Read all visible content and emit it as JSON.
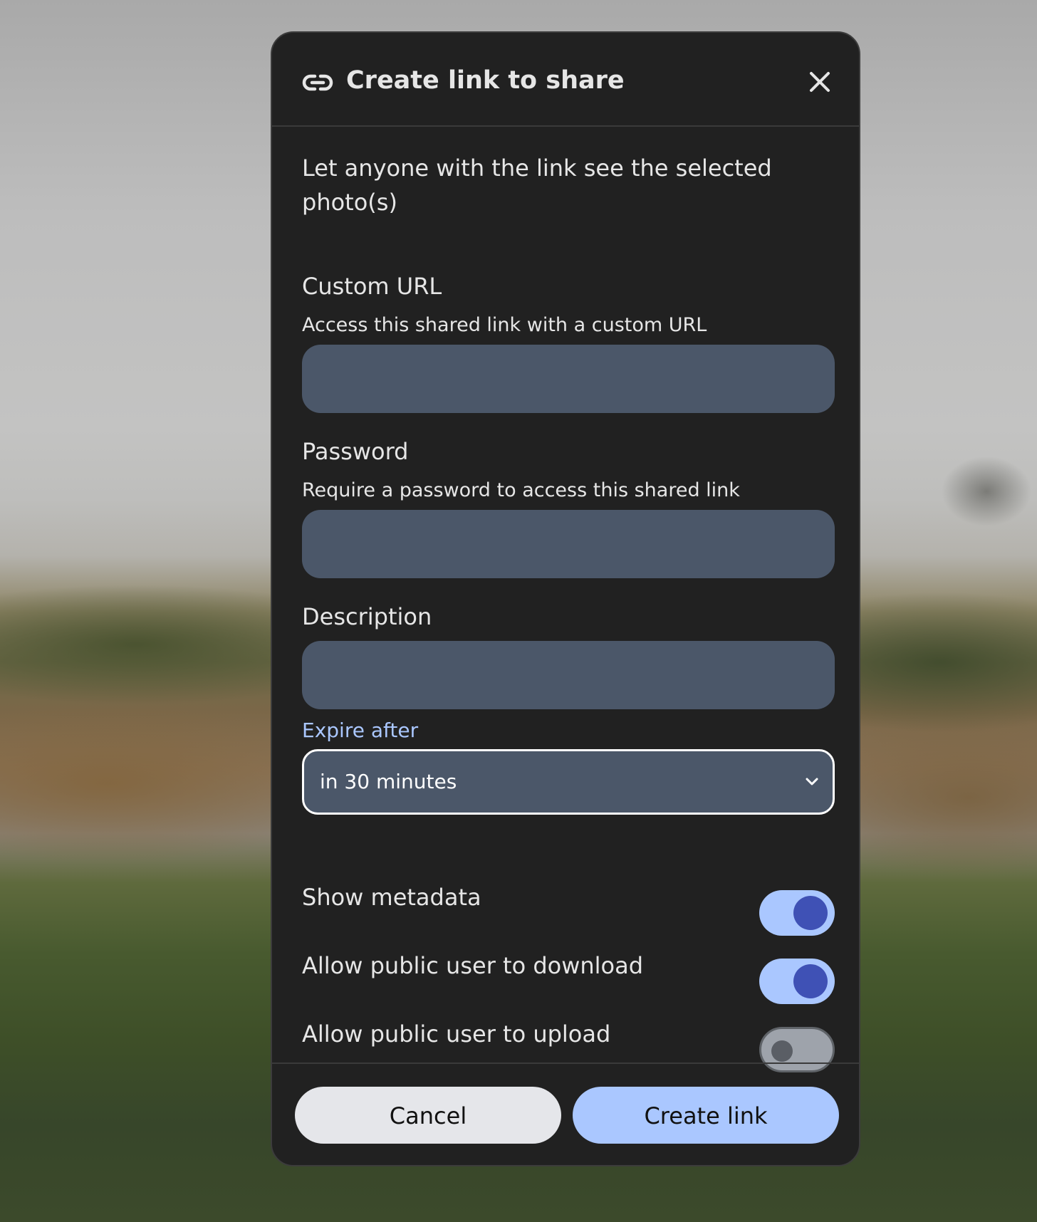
{
  "dialog": {
    "title": "Create link to share",
    "title_icon": "link-icon",
    "close_icon": "close-icon",
    "intro": "Let anyone with the link see the selected photo(s)"
  },
  "fields": {
    "custom_url": {
      "label": "Custom URL",
      "help": "Access this shared link with a custom URL",
      "value": ""
    },
    "password": {
      "label": "Password",
      "help": "Require a password to access this shared link",
      "value": ""
    },
    "description": {
      "label": "Description",
      "value": ""
    }
  },
  "expire": {
    "label": "Expire after",
    "selected": "in 30 minutes",
    "icon": "chevron-down-icon"
  },
  "toggles": {
    "show_metadata": {
      "label": "Show metadata",
      "enabled": true
    },
    "allow_download": {
      "label": "Allow public user to download",
      "enabled": true
    },
    "allow_upload": {
      "label": "Allow public user to upload",
      "enabled": false
    }
  },
  "buttons": {
    "cancel": "Cancel",
    "create": "Create link"
  },
  "colors": {
    "dialog_bg": "#212121",
    "input_bg": "#4b5769",
    "accent": "#aac7ff",
    "toggle_knob_on": "#3f51b5"
  }
}
